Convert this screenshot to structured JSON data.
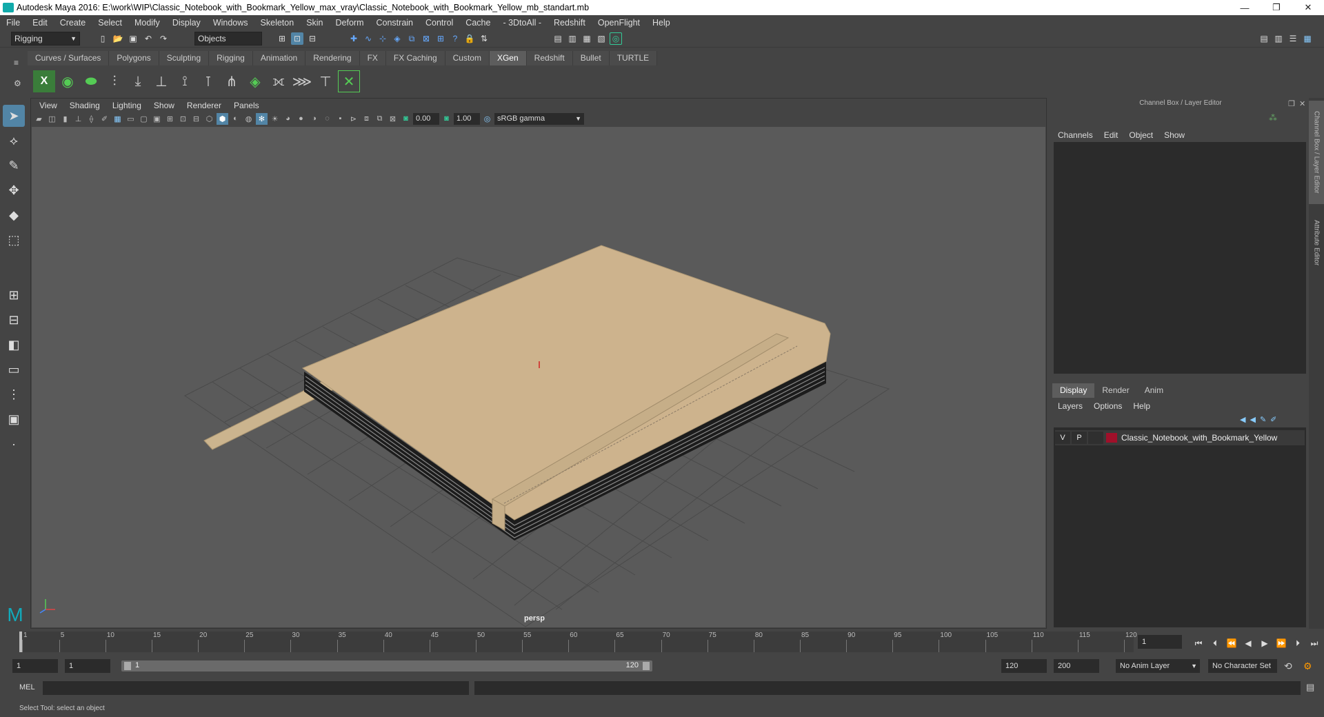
{
  "window": {
    "title": "Autodesk Maya 2016: E:\\work\\WIP\\Classic_Notebook_with_Bookmark_Yellow_max_vray\\Classic_Notebook_with_Bookmark_Yellow_mb_standart.mb",
    "minimize": "—",
    "restore": "❐",
    "close": "✕"
  },
  "menubar": [
    "File",
    "Edit",
    "Create",
    "Select",
    "Modify",
    "Display",
    "Windows",
    "Skeleton",
    "Skin",
    "Deform",
    "Constrain",
    "Control",
    "Cache",
    "- 3DtoAll -",
    "Redshift",
    "OpenFlight",
    "Help"
  ],
  "statusline": {
    "menuset": "Rigging",
    "selection_mode": "Objects"
  },
  "shelf": {
    "tabs": [
      "Curves / Surfaces",
      "Polygons",
      "Sculpting",
      "Rigging",
      "Animation",
      "Rendering",
      "FX",
      "FX Caching",
      "Custom",
      "XGen",
      "Redshift",
      "Bullet",
      "TURTLE"
    ],
    "active_tab": "XGen"
  },
  "viewport": {
    "menus": [
      "View",
      "Shading",
      "Lighting",
      "Show",
      "Renderer",
      "Panels"
    ],
    "exposure": "0.00",
    "gamma": "1.00",
    "color_space": "sRGB gamma",
    "camera_label": "persp"
  },
  "channel_box": {
    "title": "Channel Box / Layer Editor",
    "menus": [
      "Channels",
      "Edit",
      "Object",
      "Show"
    ]
  },
  "layer_editor": {
    "tabs": [
      "Display",
      "Render",
      "Anim"
    ],
    "active_tab": "Display",
    "menus": [
      "Layers",
      "Options",
      "Help"
    ],
    "layers": [
      {
        "visible": "V",
        "playback": "P",
        "name": "Classic_Notebook_with_Bookmark_Yellow",
        "color": "#a0102a"
      }
    ]
  },
  "side_tabs": {
    "channel_box": "Channel Box / Layer Editor",
    "attribute_editor": "Attribute Editor"
  },
  "timeline": {
    "ticks": [
      "1",
      "5",
      "10",
      "15",
      "20",
      "25",
      "30",
      "35",
      "40",
      "45",
      "50",
      "55",
      "60",
      "65",
      "70",
      "75",
      "80",
      "85",
      "90",
      "95",
      "100",
      "105",
      "110",
      "115",
      "120"
    ],
    "current_frame": "1"
  },
  "range": {
    "start": "1",
    "playback_start": "1",
    "slider_start": "1",
    "slider_end": "120",
    "playback_end": "120",
    "end": "200",
    "anim_layer": "No Anim Layer",
    "character_set": "No Character Set"
  },
  "command_line": {
    "label": "MEL"
  },
  "help_line": {
    "text": "Select Tool: select an object"
  }
}
